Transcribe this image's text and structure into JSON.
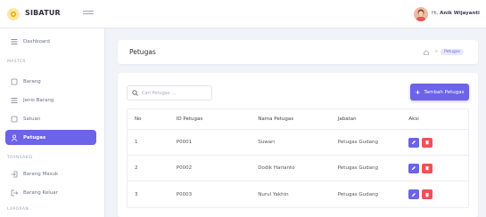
{
  "app": {
    "brand": "SIBATUR"
  },
  "user": {
    "greeting": "Hi,",
    "name": "Anik Wijayanti"
  },
  "sidebar": {
    "dashboard": "Dashboard",
    "heading_master": "MASTER",
    "barang": "Barang",
    "jenis_barang": "Jenis Barang",
    "satuan": "Satuan",
    "petugas": "Petugas",
    "heading_transaksi": "TRANSAKSI",
    "barang_masuk": "Barang Masuk",
    "barang_keluar": "Barang Keluar",
    "heading_laporan": "LAPORAN"
  },
  "page": {
    "title": "Petugas",
    "breadcrumb_sep": ">",
    "breadcrumb_current": "Petugas"
  },
  "search": {
    "placeholder": "Cari Petugas ..."
  },
  "actions": {
    "add_label": "Tambah Petugas"
  },
  "table": {
    "headers": {
      "no": "No",
      "id": "ID Petugas",
      "nama": "Nama Petugas",
      "jabatan": "Jabatan",
      "aksi": "Aksi"
    },
    "rows": [
      {
        "no": "1",
        "id": "P0001",
        "nama": "Suwari",
        "jabatan": "Petugas Gudang"
      },
      {
        "no": "2",
        "id": "P0002",
        "nama": "Dodik Harianto",
        "jabatan": "Petugas Gudang"
      },
      {
        "no": "3",
        "id": "P0003",
        "nama": "Nurul Yakhin",
        "jabatan": "Petugas Gudang"
      }
    ]
  },
  "colors": {
    "accent": "#6c63e8",
    "danger": "#f0505a",
    "background": "#f2f3f9"
  },
  "icons": {
    "logo": "logo-icon",
    "menu": "menu-icon",
    "home": "home-icon",
    "search": "search-icon",
    "edit": "edit-icon",
    "delete": "delete-icon"
  }
}
